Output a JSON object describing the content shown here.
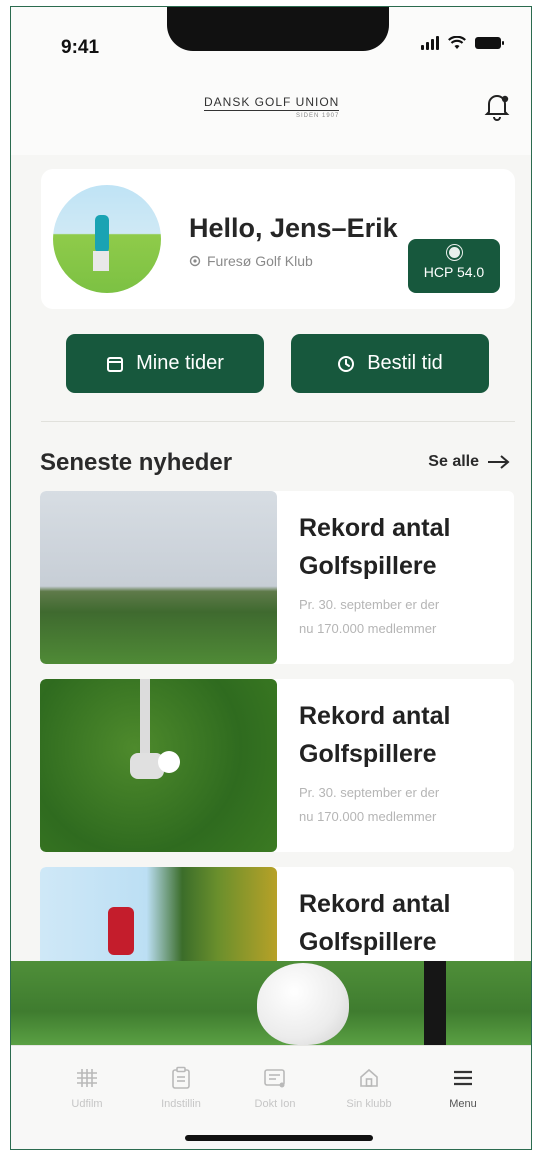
{
  "status_bar": {
    "time": "9:41"
  },
  "header": {
    "logo_main": "DANSK GOLF UNION",
    "logo_sub": "SIDEN 1907",
    "bell_icon": "bell-icon"
  },
  "profile": {
    "greeting": "Hello, Jens–Erik",
    "club": "Furesø Golf Klub",
    "hcp": "HCP 54.0"
  },
  "actions": {
    "mine_tider": "Mine tider",
    "bestil_tid": "Bestil tid"
  },
  "news": {
    "title": "Seneste nyheder",
    "see_all": "Se alle",
    "items": [
      {
        "headline": "Rekord antal Golfspillere",
        "line1": "Pr. 30. september er der",
        "line2": "nu 170.000 medlemmer"
      },
      {
        "headline": "Rekord antal Golfspillere",
        "line1": "Pr. 30. september er der",
        "line2": "nu 170.000 medlemmer"
      },
      {
        "headline": "Rekord antal Golfspillere"
      }
    ]
  },
  "tabbar": {
    "items": [
      {
        "label": "Udfilm",
        "icon": "grid-icon"
      },
      {
        "label": "Indstillin",
        "icon": "clipboard-icon"
      },
      {
        "label": "Dokt Ion",
        "icon": "card-icon"
      },
      {
        "label": "Sin klubb",
        "icon": "home-icon"
      },
      {
        "label": "Menu",
        "icon": "menu-icon"
      }
    ]
  },
  "colors": {
    "brand_green": "#17583d"
  }
}
